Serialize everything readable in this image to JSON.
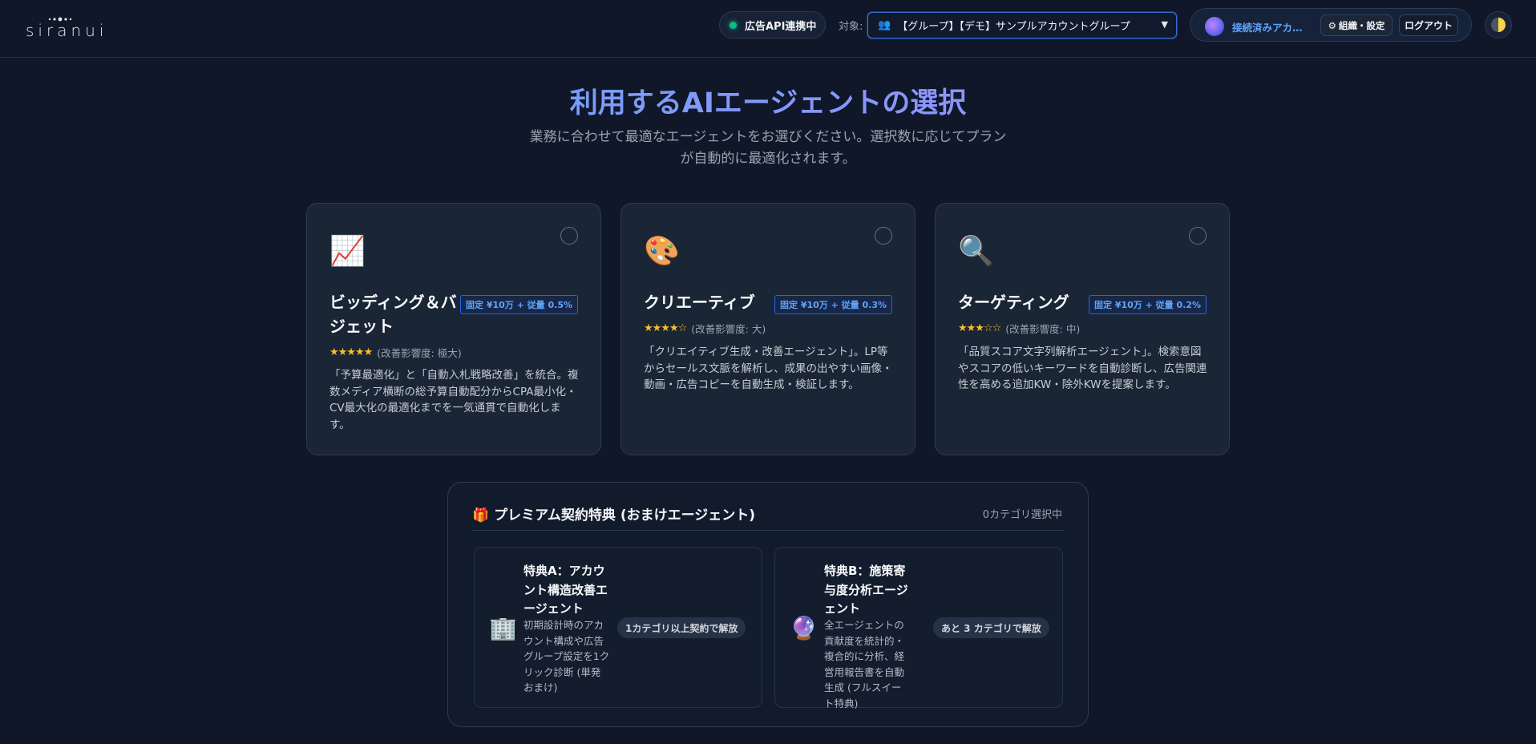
{
  "header": {
    "logo_text": "siranui",
    "api_status": "広告API連携中",
    "target_label": "対象:",
    "target_icon": "group-icon",
    "target_value": "【グループ】【デモ】サンプルアカウントグループ",
    "user_name": "接続済みアカウ...",
    "org_settings_label": "組織・設定",
    "logout_label": "ログアウト",
    "theme_toggle_icon": "half-moon-icon"
  },
  "hero": {
    "title": "利用するAIエージェントの選択",
    "subtitle": "業務に合わせて最適なエージェントをお選びください。選択数に応じてプランが自動的に最適化されます。"
  },
  "agents": [
    {
      "icon": "📈",
      "title": "ビッディング＆バジェット",
      "price": "固定 ¥10万 + 従量 0.5%",
      "stars": "★★★★★",
      "rating": 5,
      "impact": "(改善影響度: 極大)",
      "description": "「予算最適化」と「自動入札戦略改善」を統合。複数メディア横断の総予算自動配分からCPA最小化・CV最大化の最適化までを一気通貫で自動化します。",
      "selected": false
    },
    {
      "icon": "🎨",
      "title": "クリエーティブ",
      "price": "固定 ¥10万 + 従量 0.3%",
      "stars": "★★★★☆",
      "rating": 4,
      "impact": "(改善影響度: 大)",
      "description": "「クリエイティブ生成・改善エージェント」。LP等からセールス文脈を解析し、成果の出やすい画像・動画・広告コピーを自動生成・検証します。",
      "selected": false
    },
    {
      "icon": "🔍",
      "title": "ターゲティング",
      "price": "固定 ¥10万 + 従量 0.2%",
      "stars": "★★★☆☆",
      "rating": 3,
      "impact": "(改善影響度: 中)",
      "description": "「品質スコア文字列解析エージェント」。検索意図やスコアの低いキーワードを自動診断し、広告関連性を高める追加KW・除外KWを提案します。",
      "selected": false
    }
  ],
  "premium": {
    "title": "🎁 プレミアム契約特典 (おまけエージェント)",
    "selected_count": "0カテゴリ選択中",
    "bonuses": [
      {
        "icon": "🏢",
        "title": "特典A：アカウント構造改善エージェント",
        "description": "初期設計時のアカウント構成や広告グループ設定を1クリック診断 (単発おまけ)",
        "unlock": "1カテゴリ以上契約で解放"
      },
      {
        "icon": "🔮",
        "title": "特典B：施策寄与度分析エージェント",
        "description": "全エージェントの貢献度を統計的・複合的に分析、経営用報告書を自動生成 (フルスイート特典)",
        "unlock": "あと 3 カテゴリで解放"
      }
    ]
  },
  "colors": {
    "background": "#0f1729",
    "card": "#1a2535",
    "accent_blue": "#60a5fa",
    "accent_purple": "#a78bfa",
    "status_green": "#10b981",
    "star": "#fbbf24"
  }
}
